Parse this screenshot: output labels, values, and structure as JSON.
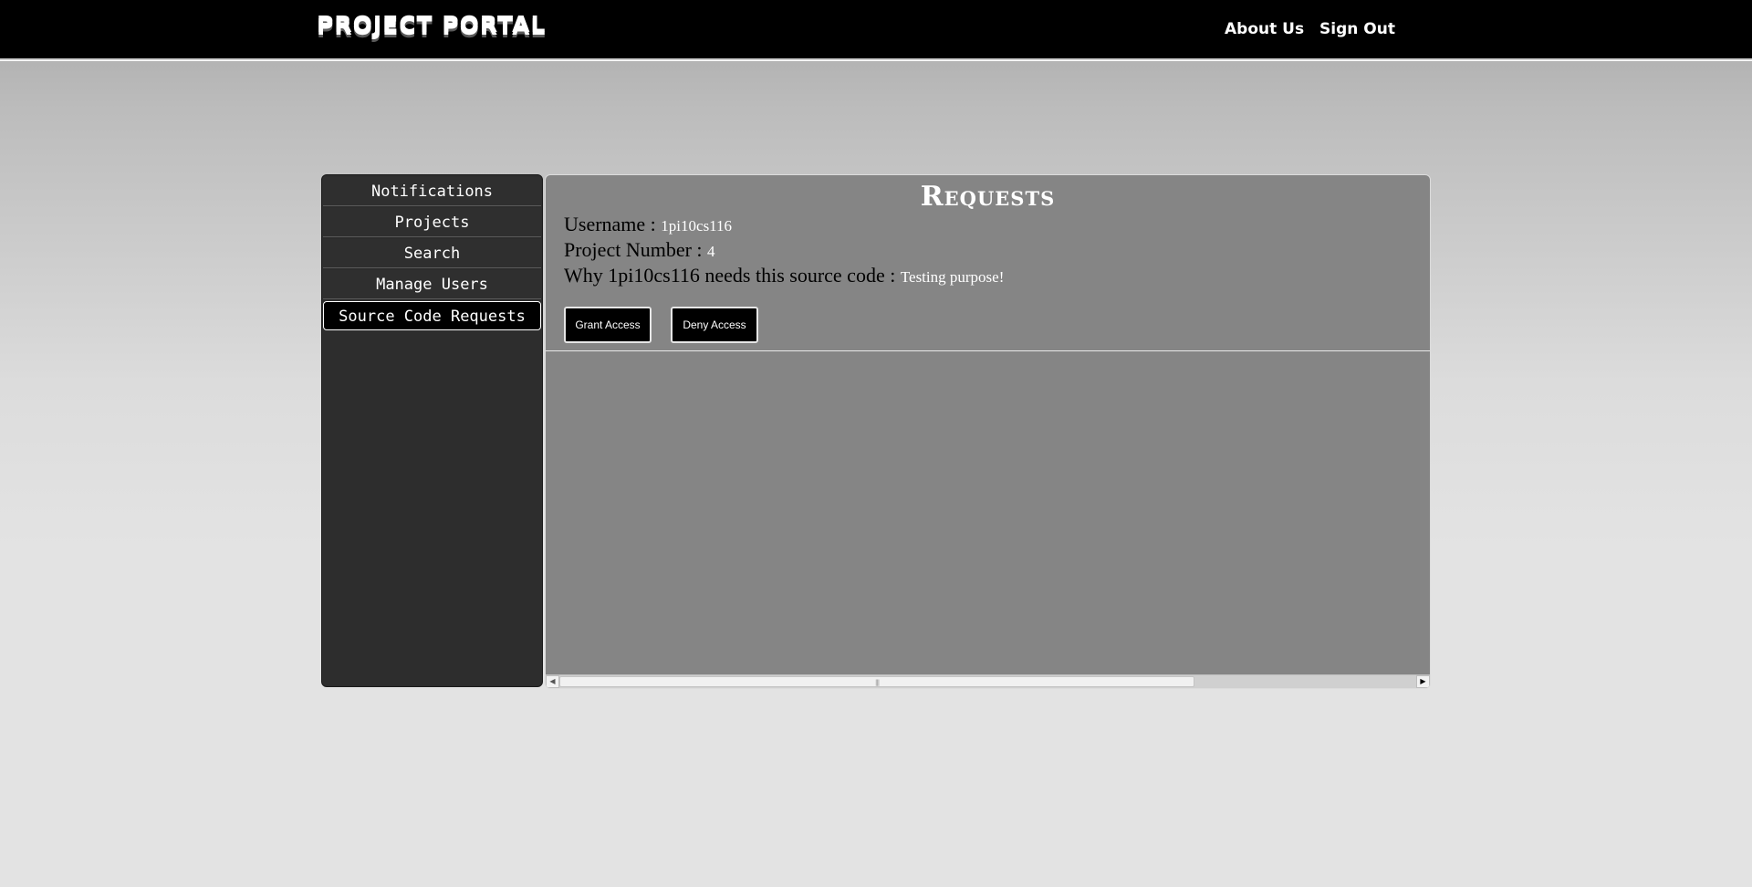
{
  "header": {
    "logo": "PROJECT PORTAL",
    "nav": {
      "about": "About Us",
      "signout": "Sign Out"
    }
  },
  "sidebar": {
    "items": [
      {
        "label": "Notifications"
      },
      {
        "label": "Projects"
      },
      {
        "label": "Search"
      },
      {
        "label": "Manage Users"
      },
      {
        "label": "Source Code Requests"
      }
    ]
  },
  "main": {
    "title": "Requests",
    "username_label": "Username : ",
    "username_value": "1pi10cs116",
    "project_label": "Project Number : ",
    "project_value": "4",
    "why_label": "Why 1pi10cs116 needs this source code : ",
    "why_value": "Testing purpose!",
    "grant_label": "Grant Access",
    "deny_label": "Deny Access"
  }
}
